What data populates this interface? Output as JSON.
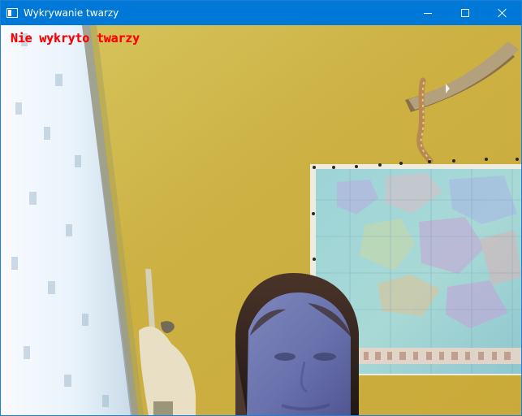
{
  "window": {
    "title": "Wykrywanie twarzy",
    "title_bar_color": "#0078d7"
  },
  "icons": {
    "app": "opencv-window-icon",
    "minimize": "minimize-icon",
    "maximize": "maximize-icon",
    "close": "close-icon"
  },
  "overlay": {
    "status_text": "Nie wykryto twarzy",
    "status_color": "#ff0000"
  }
}
